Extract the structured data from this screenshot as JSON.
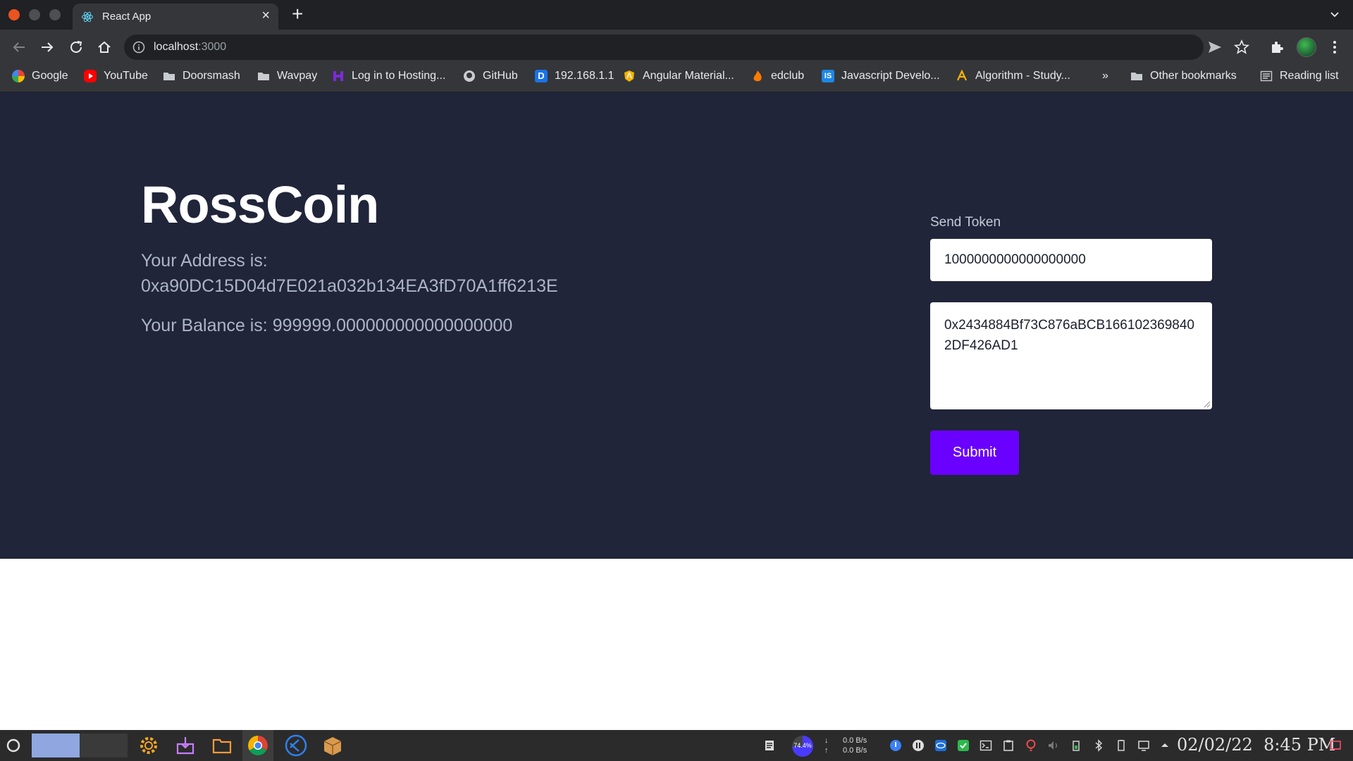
{
  "browser": {
    "tab_title": "React App",
    "new_tab_glyph": "+",
    "close_glyph": "×",
    "url_host": "localhost",
    "url_port": ":3000"
  },
  "bookmarks": [
    {
      "label": "Google",
      "icon": "google-icon",
      "color": "#4285f4"
    },
    {
      "label": "YouTube",
      "icon": "youtube-icon",
      "color": "#ff0000"
    },
    {
      "label": "Doorsmash",
      "icon": "folder-icon",
      "color": "#c8ccd1"
    },
    {
      "label": "Wavpay",
      "icon": "folder-icon",
      "color": "#c8ccd1"
    },
    {
      "label": "Log in to Hosting...",
      "icon": "hosting-icon",
      "color": "#7c2bd9"
    },
    {
      "label": "GitHub",
      "icon": "github-icon",
      "color": "#c8ccd1"
    },
    {
      "label": "192.168.1.1",
      "icon": "router-icon",
      "color": "#1a73e8"
    },
    {
      "label": "Angular Material...",
      "icon": "angular-icon",
      "color": "#f4b400"
    },
    {
      "label": "edclub",
      "icon": "edclub-icon",
      "color": "#ff7b00"
    },
    {
      "label": "Javascript Develo...",
      "icon": "js-icon",
      "color": "#1e88e5"
    },
    {
      "label": "Algorithm - Study...",
      "icon": "algorithm-icon",
      "color": "#f4b400"
    }
  ],
  "bookmarks_overflow": "»",
  "other_bookmarks": "Other bookmarks",
  "reading_list": "Reading list",
  "app": {
    "brand": "RossCoin",
    "address_label": "Your Address is:",
    "address_value": "0xa90DC15D04d7E021a032b134EA3fD70A1ff6213E",
    "balance_label": "Your Balance is:",
    "balance_value": "999999.000000000000000000"
  },
  "form": {
    "label": "Send Token",
    "amount_value": "1000000000000000000",
    "recipient_value": "0x2434884Bf73C876aBCB1661023698402DF426AD1",
    "submit_label": "Submit"
  },
  "taskbar": {
    "cpu_percent": "74.4%",
    "net_down": "0.0 B/s",
    "net_up": "0.0 B/s",
    "date": "02/02/22",
    "time": "8:45 PM"
  },
  "colors": {
    "page_bg": "#20253a",
    "accent": "#6a00ff",
    "muted_text": "#aeb4c7"
  }
}
